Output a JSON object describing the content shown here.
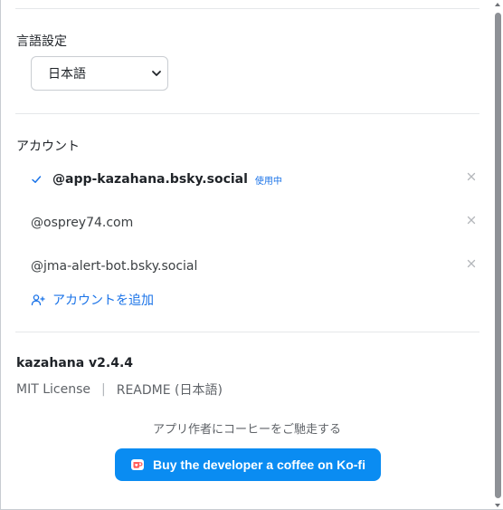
{
  "language": {
    "title": "言語設定",
    "selected": "日本語"
  },
  "accounts": {
    "title": "アカウント",
    "items": [
      {
        "handle": "@app-kazahana.bsky.social",
        "active": true,
        "badge": "使用中"
      },
      {
        "handle": "@osprey74.com",
        "active": false
      },
      {
        "handle": "@jma-alert-bot.bsky.social",
        "active": false
      }
    ],
    "add_label": "アカウントを追加"
  },
  "about": {
    "version": "kazahana v2.4.4",
    "license": "MIT License",
    "separator": "|",
    "readme": "README (日本語)"
  },
  "coffee": {
    "caption": "アプリ作者にコーヒーをご馳走する",
    "button_label": "Buy the developer a coffee on Ko-fi"
  },
  "colors": {
    "accent": "#1a73e8",
    "kofi_button": "#0a8cf2"
  },
  "icons": {
    "check": "check-icon",
    "remove": "close-icon",
    "add_user": "add-user-icon",
    "dropdown": "chevron-down-icon",
    "kofi": "kofi-cup-icon"
  }
}
